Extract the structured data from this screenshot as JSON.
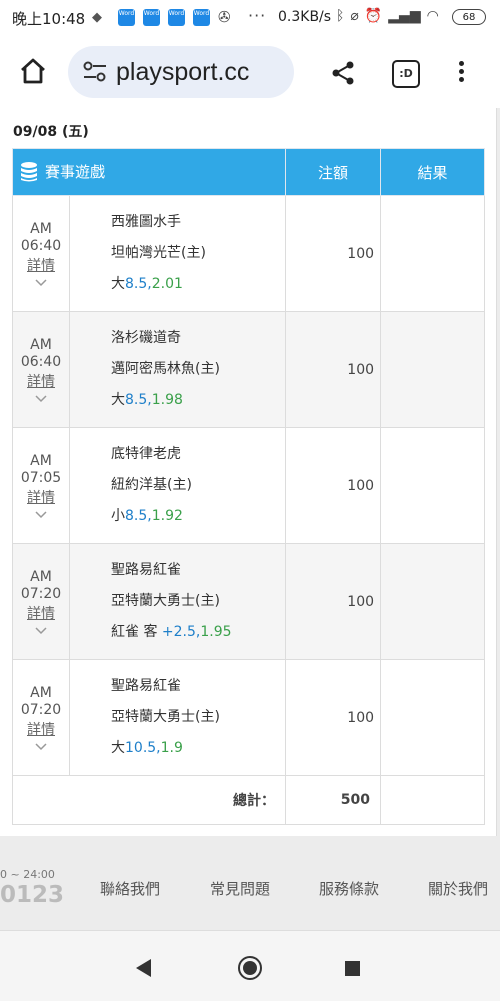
{
  "status_bar": {
    "time": "晚上10:48",
    "speed": "0.3KB/s",
    "battery": "68",
    "app_badges": [
      "Word",
      "Word",
      "Word",
      "Word"
    ]
  },
  "browser": {
    "url": "playsport.cc",
    "tabs_label": ":D"
  },
  "page": {
    "date": "09/08 (五)",
    "headers": {
      "game": "賽事遊戲",
      "amount": "注額",
      "result": "結果"
    },
    "detail_label": "詳情",
    "bets": [
      {
        "ampm": "AM",
        "time": "06:40",
        "away": "西雅圖水手",
        "home": "坦帕灣光芒(主)",
        "pick_prefix": "大",
        "line": "8.5",
        "odds": "2.01",
        "amount": "100",
        "result": ""
      },
      {
        "ampm": "AM",
        "time": "06:40",
        "away": "洛杉磯道奇",
        "home": "邁阿密馬林魚(主)",
        "pick_prefix": "大",
        "line": "8.5",
        "odds": "1.98",
        "amount": "100",
        "result": ""
      },
      {
        "ampm": "AM",
        "time": "07:05",
        "away": "底特律老虎",
        "home": "紐約洋基(主)",
        "pick_prefix": "小",
        "line": "8.5",
        "odds": "1.92",
        "amount": "100",
        "result": ""
      },
      {
        "ampm": "AM",
        "time": "07:20",
        "away": "聖路易紅雀",
        "home": "亞特蘭大勇士(主)",
        "pick_prefix": "紅雀 客",
        "line": "+2.5",
        "odds": "1.95",
        "amount": "100",
        "result": ""
      },
      {
        "ampm": "AM",
        "time": "07:20",
        "away": "聖路易紅雀",
        "home": "亞特蘭大勇士(主)",
        "pick_prefix": "大",
        "line": "10.5",
        "odds": "1.9",
        "amount": "100",
        "result": ""
      }
    ],
    "total_label": "總計：",
    "total_value": "500"
  },
  "footer": {
    "hours": "0 ~ 24:00",
    "phone": "0123",
    "links": [
      "聯絡我們",
      "常見問題",
      "服務條款",
      "關於我們"
    ]
  },
  "colors": {
    "header_blue": "#30a8e6",
    "line_blue": "#1e7fc9",
    "odds_green": "#3aa04a"
  }
}
